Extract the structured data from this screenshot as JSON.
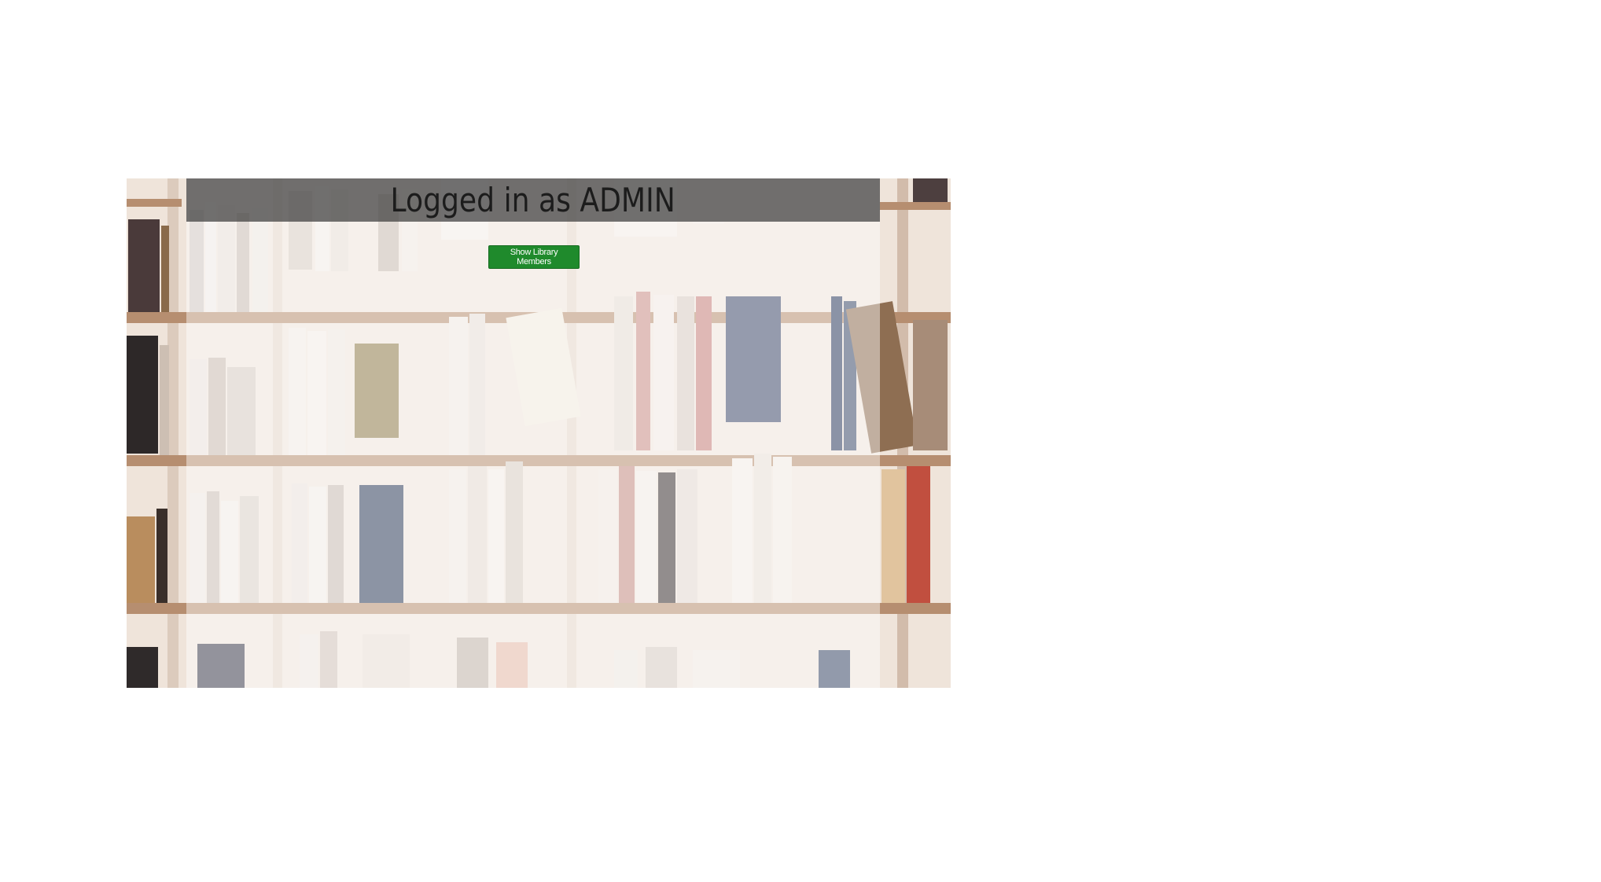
{
  "header": {
    "title": "Logged in as ADMIN"
  },
  "actions": {
    "show_members_label": "Show Library Members"
  },
  "colors": {
    "header_bar": "#3c3c3c",
    "button": "#1f8a2c",
    "button_text": "#ffffff",
    "overlay": "#ffffff"
  },
  "background": {
    "icon": "bookshelf-background"
  }
}
